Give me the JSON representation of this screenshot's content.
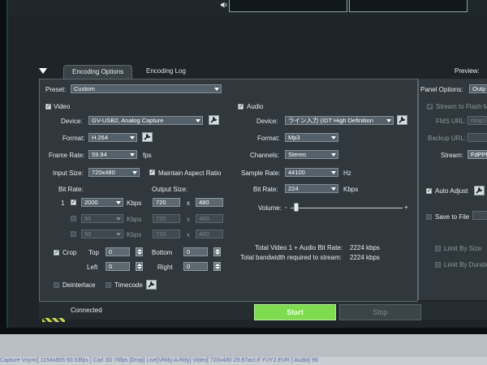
{
  "tabs": {
    "encoding_options": "Encoding Options",
    "encoding_log": "Encoding Log"
  },
  "preview_label": "Preview:",
  "preset": {
    "label": "Preset:",
    "value": "Custom"
  },
  "panel_options": {
    "label": "Panel Options:",
    "value": "Outp"
  },
  "video": {
    "section_label": "Video",
    "device_label": "Device:",
    "device_value": "GV-USB2, Analog Capture",
    "format_label": "Format:",
    "format_value": "H.264",
    "frame_rate_label": "Frame Rate:",
    "frame_rate_value": "59.94",
    "frame_rate_unit": "fps",
    "input_size_label": "Input Size:",
    "input_size_value": "720x480",
    "maintain_aspect_label": "Maintain Aspect Ratio",
    "bit_rate_label": "Bit Rate:",
    "output_size_label": "Output Size:",
    "rows": [
      {
        "index": "1",
        "bitrate": "2000",
        "unit": "Kbps",
        "w": "720",
        "h": "480",
        "x": "x"
      },
      {
        "index": "",
        "bitrate": "50",
        "unit": "Kbps",
        "w": "720",
        "h": "480",
        "x": "x"
      },
      {
        "index": "",
        "bitrate": "50",
        "unit": "Kbps",
        "w": "720",
        "h": "480",
        "x": "x"
      }
    ],
    "crop_label": "Crop",
    "top_label": "Top",
    "top_value": "0",
    "bottom_label": "Bottom",
    "bottom_value": "0",
    "left_label": "Left",
    "left_value": "0",
    "right_label": "Right",
    "right_value": "0",
    "deinterlace_label": "Deinterlace",
    "timecode_label": "Timecode"
  },
  "audio": {
    "section_label": "Audio",
    "device_label": "Device:",
    "device_value": "ライン入力 (IDT High Definition",
    "format_label": "Format:",
    "format_value": "Mp3",
    "channels_label": "Channels:",
    "channels_value": "Stereo",
    "sample_rate_label": "Sample Rate:",
    "sample_rate_value": "44100",
    "sample_rate_unit": "Hz",
    "bit_rate_label": "Bit Rate:",
    "bit_rate_value": "224",
    "bit_rate_unit": "Kbps",
    "volume_label": "Volume:",
    "volume_minus": "-",
    "volume_plus": "+",
    "volume_level": 0.05
  },
  "totals": {
    "total_label": "Total Video 1 + Audio Bit Rate:",
    "total_value": "2224 kbps",
    "bandwidth_label": "Total bandwidth required to stream:",
    "bandwidth_value": "2224 kbps"
  },
  "right_panel": {
    "stream_flash_label": "Stream to Flash M",
    "fms_url_label": "FMS URL:",
    "fms_url_value": "rtmp:/",
    "backup_url_label": "Backup URL:",
    "stream_label": "Stream:",
    "stream_value": "FdPPD",
    "auto_adjust_label": "Auto Adjust",
    "save_to_file_label": "Save to File",
    "limit_by_size_label": "Limit By Size",
    "limit_by_duration_label": "Limit By Duratio"
  },
  "status": {
    "connected": "Connected",
    "start": "Start",
    "stop": "Stop"
  },
  "bottom_bar": "Capture        Vsync[ 1154x855 60.53fps ]  Carl 3D 76fps [Drop]  Live[VRdy:A:Rdy]        Video[ 720x480 29.97act.tf YUY2 EVR ]  Audio[ 96"
}
